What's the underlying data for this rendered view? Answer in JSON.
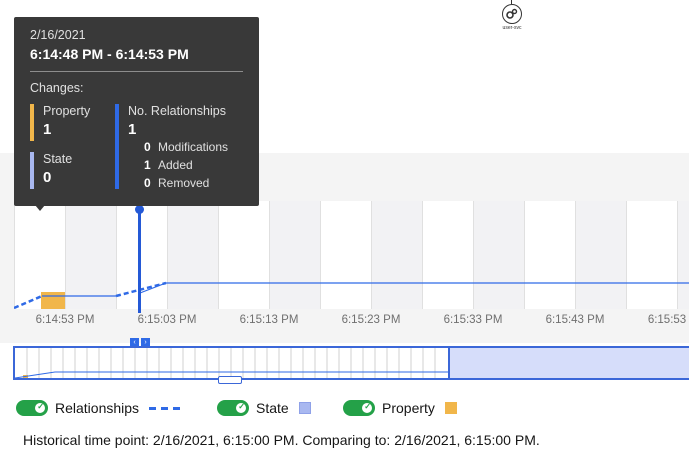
{
  "node": {
    "label": "user-svc",
    "icon": "gears-icon"
  },
  "chart": {
    "x_ticks": [
      "6:14:53 PM",
      "6:15:03 PM",
      "6:15:13 PM",
      "6:15:23 PM",
      "6:15:33 PM",
      "6:15:43 PM",
      "6:15:53"
    ],
    "colors": {
      "relationships": "#2f6ae6",
      "state": "#a9b8f0",
      "property": "#f1b64a"
    }
  },
  "legend": {
    "relationships": "Relationships",
    "state": "State",
    "property": "Property"
  },
  "footer": {
    "text": "Historical time point: 2/16/2021, 6:15:00 PM. Comparing to: 2/16/2021, 6:15:00 PM."
  },
  "tooltip": {
    "date": "2/16/2021",
    "range": "6:14:48 PM - 6:14:53 PM",
    "changes_label": "Changes:",
    "property_label": "Property",
    "property_value": "1",
    "state_label": "State",
    "state_value": "0",
    "relationships_label": "No. Relationships",
    "relationships_value": "1",
    "modifications_value": "0",
    "modifications_label": "Modifications",
    "added_value": "1",
    "added_label": "Added",
    "removed_value": "0",
    "removed_label": "Removed"
  }
}
